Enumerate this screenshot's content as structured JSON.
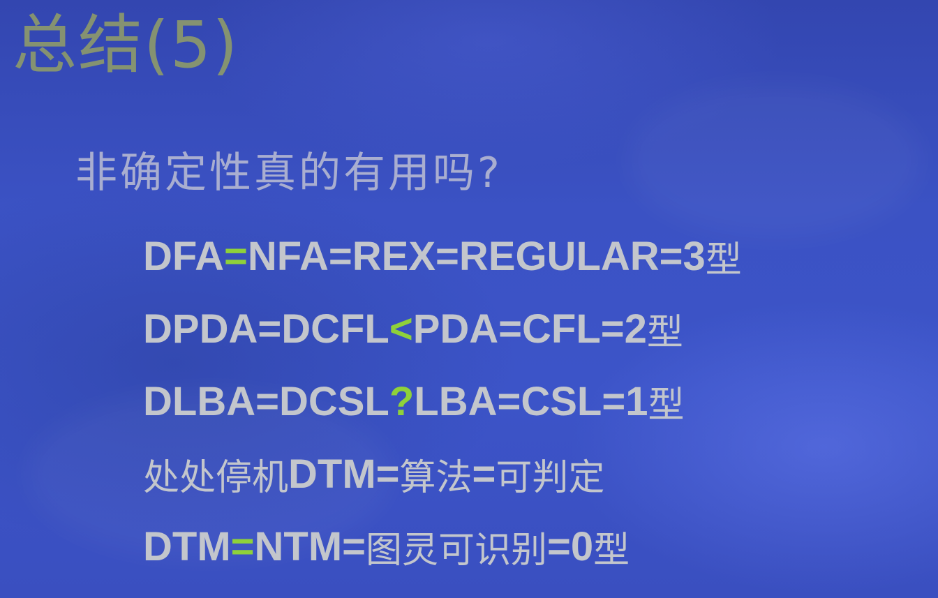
{
  "slide": {
    "title": "总结(5)",
    "question": "非确定性真的有用吗?",
    "accent_color": "#8fd13a",
    "lines": [
      {
        "pre": "DFA",
        "op": "=",
        "post": "NFA=REX=REGULAR=3",
        "suffix": "型"
      },
      {
        "pre": "DPDA=DCFL",
        "op": "<",
        "post": " PDA=CFL=2",
        "suffix": "型"
      },
      {
        "pre": "DLBA=DCSL ",
        "op": "?",
        "post": " LBA=CSL=1",
        "suffix": "型"
      },
      {
        "prefix": "处处停机",
        "text": "DTM=",
        "mid1": "算法",
        "eq": "=",
        "mid2": "可判定"
      },
      {
        "pre": "DTM",
        "op": "=",
        "post": "NTM=",
        "cjk": "图灵可识别",
        "tail": "=0",
        "suffix": "型"
      }
    ]
  }
}
